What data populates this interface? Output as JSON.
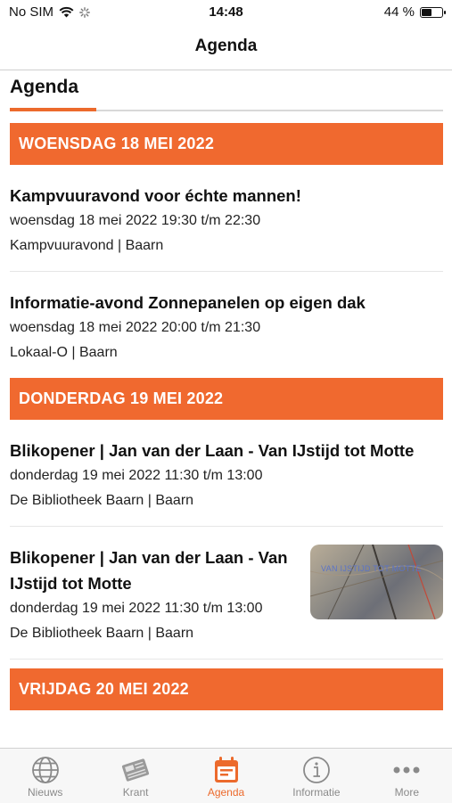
{
  "status_bar": {
    "carrier": "No SIM",
    "time": "14:48",
    "battery": "44 %",
    "battery_level": 0.44
  },
  "navbar": {
    "title": "Agenda"
  },
  "page": {
    "section_title": "Agenda"
  },
  "days": [
    {
      "header": "WOENSDAG 18 MEI 2022",
      "events": [
        {
          "title": "Kampvuuravond voor échte mannen!",
          "date": "woensdag 18 mei 2022 19:30 t/m 22:30",
          "location": "Kampvuuravond | Baarn"
        },
        {
          "title": "Informatie-avond Zonnepanelen op eigen dak",
          "date": "woensdag 18 mei 2022 20:00 t/m 21:30",
          "location": "Lokaal-O | Baarn"
        }
      ]
    },
    {
      "header": "DONDERDAG 19 MEI 2022",
      "events": [
        {
          "title": "Blikopener | Jan van der Laan - Van IJstijd tot Motte",
          "date": "donderdag 19 mei 2022 11:30 t/m 13:00",
          "location": "De Bibliotheek Baarn | Baarn"
        },
        {
          "title": "Blikopener | Jan van der Laan - Van IJstijd tot Motte",
          "date": "donderdag 19 mei 2022 11:30 t/m 13:00",
          "location": "De Bibliotheek Baarn | Baarn",
          "thumbnail_caption": "VAN IJSTIJD TOT MOTTE"
        }
      ]
    },
    {
      "header": "VRIJDAG 20 MEI 2022",
      "events": []
    }
  ],
  "tabbar": {
    "tabs": [
      {
        "label": "Nieuws",
        "icon": "globe-icon",
        "active": false
      },
      {
        "label": "Krant",
        "icon": "newspaper-icon",
        "active": false
      },
      {
        "label": "Agenda",
        "icon": "calendar-icon",
        "active": true
      },
      {
        "label": "Informatie",
        "icon": "info-icon",
        "active": false
      },
      {
        "label": "More",
        "icon": "more-icon",
        "active": false
      }
    ]
  },
  "colors": {
    "accent": "#f0692f",
    "inactive": "#8a8a8a"
  }
}
